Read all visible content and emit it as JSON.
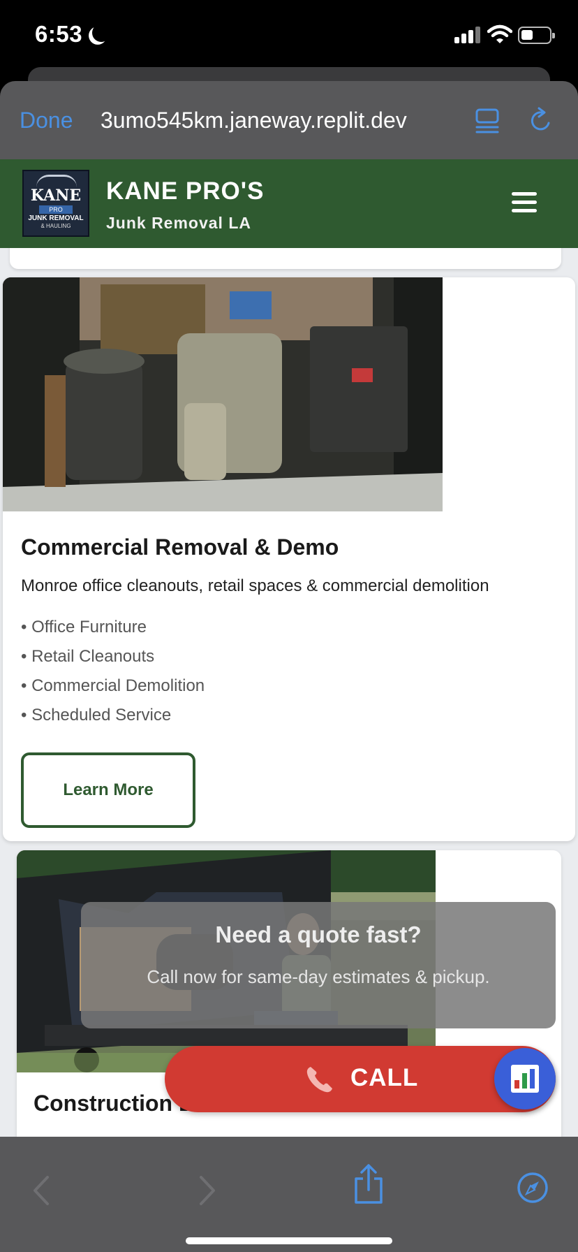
{
  "status_bar": {
    "time": "6:53"
  },
  "browser": {
    "done_label": "Done",
    "url": "3umo545km.janeway.replit.dev"
  },
  "header": {
    "brand_name": "KANE PRO'S",
    "brand_tagline": "Junk Removal LA",
    "logo": {
      "line1": "KANE",
      "line2": "PRO",
      "line3": "JUNK REMOVAL",
      "line4": "& HAULING"
    }
  },
  "service_card": {
    "title": "Commercial Removal & Demo",
    "description": "Monroe office cleanouts, retail spaces & commercial demolition",
    "features": [
      "• Office Furniture",
      "• Retail Cleanouts",
      "• Commercial Demolition",
      "• Scheduled Service"
    ],
    "button_label": "Learn More"
  },
  "next_card": {
    "title": "Construction Debris & Demolition"
  },
  "quote_popup": {
    "title": "Need a quote fast?",
    "subtitle": "Call now for same-day estimates & pickup."
  },
  "call_button": {
    "label": "CALL"
  },
  "colors": {
    "brand_green": "#2f5a30",
    "call_red": "#d13a32",
    "fab_blue": "#3a5fd8",
    "safari_blue": "#4a90e2"
  },
  "icons": [
    "moon-icon",
    "signal-icon",
    "wifi-icon",
    "battery-icon",
    "reader-mode-icon",
    "reload-icon",
    "hamburger-menu-icon",
    "phone-icon",
    "bar-chart-icon",
    "back-arrow-icon",
    "forward-arrow-icon",
    "share-icon",
    "compass-icon"
  ]
}
